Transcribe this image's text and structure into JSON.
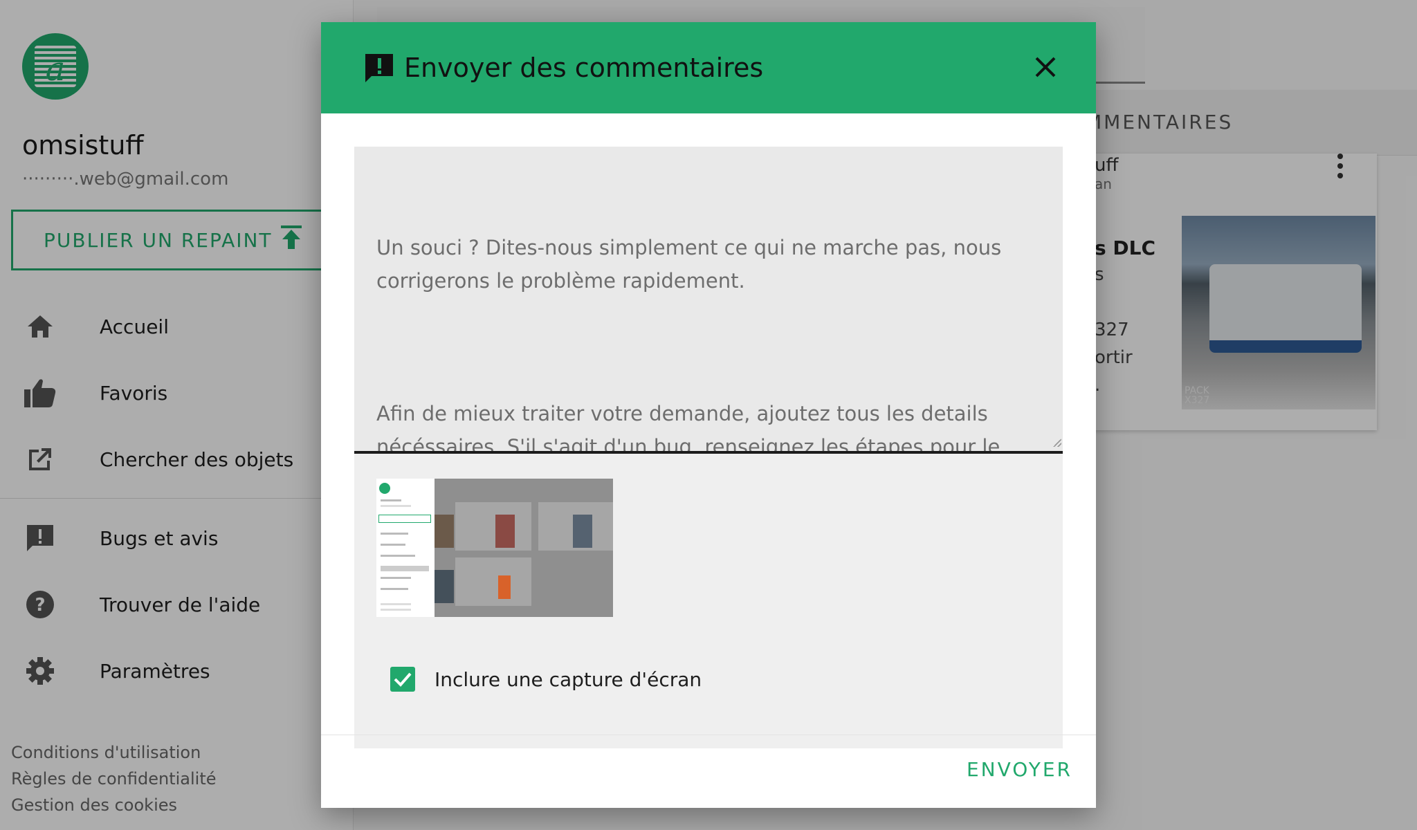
{
  "sidebar": {
    "username": "omsistuff",
    "email": "·········.web@gmail.com",
    "publish_label": "PUBLIER UN REPAINT",
    "items": [
      {
        "label": "Accueil",
        "icon": "home-icon"
      },
      {
        "label": "Favoris",
        "icon": "thumb-up-icon"
      },
      {
        "label": "Chercher des objets",
        "icon": "open-in-new-icon"
      },
      {
        "label": "Bugs et avis",
        "icon": "feedback-icon"
      },
      {
        "label": "Trouver de l'aide",
        "icon": "help-icon"
      },
      {
        "label": "Paramètres",
        "icon": "gear-icon"
      }
    ],
    "footer": {
      "terms": "Conditions d'utilisation",
      "privacy": "Règles de confidentialité",
      "cookies": "Gestion des cookies"
    }
  },
  "background": {
    "tab_comments": "MMENTAIRES",
    "card": {
      "author": "uff",
      "date": "an",
      "title": "s DLC",
      "line1": "s",
      "line2": "327",
      "line3": "ortir",
      "line4": ".",
      "photo_tag": "PACK\nX327"
    }
  },
  "dialog": {
    "title": "Envoyer des commentaires",
    "title_icon": "feedback-icon",
    "close_icon": "close-icon",
    "textarea_placeholder_p1": "Un souci ? Dites-nous simplement ce qui ne marche pas, nous corrigerons le problème rapidement.",
    "textarea_placeholder_p2": "Afin de mieux traiter votre demande, ajoutez tous les details nécéssaires. S'il s'agit d'un bug, renseignez les étapes pour le reproduire. Pour un lien non disponible, merci de le copier ci-dessous.",
    "include_screenshot_label": "Inclure une capture d'écran",
    "include_screenshot_checked": true,
    "send_label": "ENVOYER"
  },
  "colors": {
    "accent": "#21a86c",
    "header_text": "#111111",
    "placeholder_text": "#6d6d6d"
  }
}
